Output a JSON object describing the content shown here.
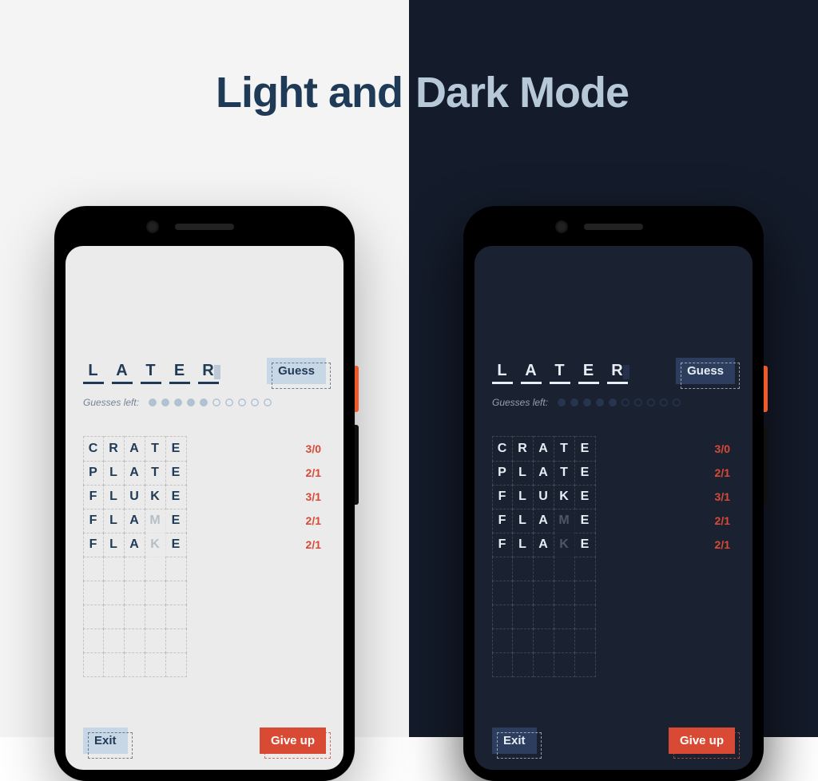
{
  "headline": {
    "left": "Light and",
    "right": "Dark Mode"
  },
  "game": {
    "input_letters": [
      "L",
      "A",
      "T",
      "E",
      "R"
    ],
    "cursor_index": 4,
    "guess_button": "Guess",
    "guesses_left_label": "Guesses left:",
    "dots_total": 10,
    "dots_filled": 5,
    "history": [
      {
        "letters": [
          {
            "ch": "C"
          },
          {
            "ch": "R"
          },
          {
            "ch": "A"
          },
          {
            "ch": "T"
          },
          {
            "ch": "E"
          }
        ],
        "score": "3/0"
      },
      {
        "letters": [
          {
            "ch": "P"
          },
          {
            "ch": "L"
          },
          {
            "ch": "A"
          },
          {
            "ch": "T"
          },
          {
            "ch": "E"
          }
        ],
        "score": "2/1"
      },
      {
        "letters": [
          {
            "ch": "F"
          },
          {
            "ch": "L"
          },
          {
            "ch": "U"
          },
          {
            "ch": "K"
          },
          {
            "ch": "E"
          }
        ],
        "score": "3/1"
      },
      {
        "letters": [
          {
            "ch": "F"
          },
          {
            "ch": "L"
          },
          {
            "ch": "A"
          },
          {
            "ch": "M",
            "dim": true
          },
          {
            "ch": "E"
          }
        ],
        "score": "2/1"
      },
      {
        "letters": [
          {
            "ch": "F"
          },
          {
            "ch": "L"
          },
          {
            "ch": "A"
          },
          {
            "ch": "K",
            "dim": true
          },
          {
            "ch": "E"
          }
        ],
        "score": "2/1"
      }
    ],
    "empty_rows": 5,
    "exit_button": "Exit",
    "giveup_button": "Give up"
  }
}
